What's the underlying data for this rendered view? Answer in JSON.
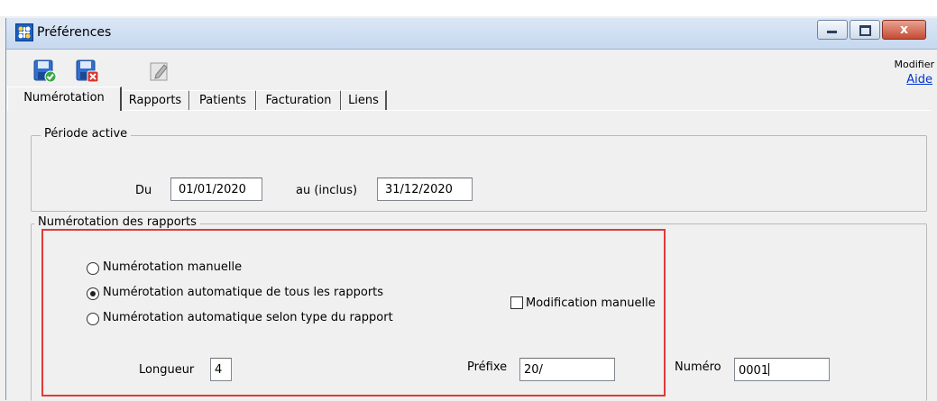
{
  "window": {
    "title": "Préférences",
    "controls": {
      "close": "x"
    }
  },
  "toolbar": {
    "modifier_label": "Modifier",
    "aide_link": "Aide"
  },
  "tabs": [
    {
      "label": "Numérotation",
      "active": true
    },
    {
      "label": "Rapports",
      "active": false
    },
    {
      "label": "Patients",
      "active": false
    },
    {
      "label": "Facturation",
      "active": false
    },
    {
      "label": "Liens",
      "active": false
    }
  ],
  "periode": {
    "title": "Période active",
    "du_label": "Du",
    "du_value": "01/01/2020",
    "au_label": "au (inclus)",
    "au_value": "31/12/2020"
  },
  "numerotation": {
    "title": "Numérotation des rapports",
    "options": [
      {
        "label": "Numérotation manuelle",
        "selected": false
      },
      {
        "label": "Numérotation automatique de tous les rapports",
        "selected": true
      },
      {
        "label": "Numérotation automatique selon type du rapport",
        "selected": false
      }
    ],
    "modification_manuelle_label": "Modification manuelle",
    "modification_manuelle_checked": false,
    "longueur_label": "Longueur",
    "longueur_value": "4",
    "prefixe_label": "Préfixe",
    "prefixe_value": "20/",
    "numero_label": "Numéro",
    "numero_value": "0001"
  },
  "colors": {
    "highlight": "#e03a3a",
    "link": "#0033cc",
    "titlebar": "#c6d8ef"
  }
}
